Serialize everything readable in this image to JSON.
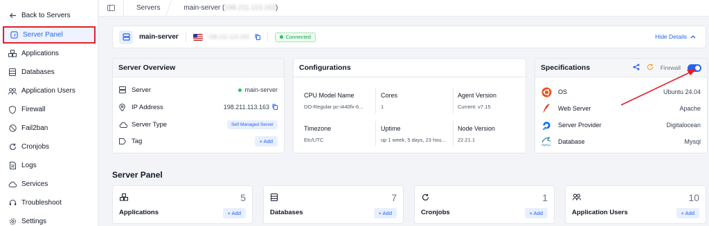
{
  "sidebar": {
    "back_label": "Back to Servers",
    "items": [
      {
        "label": "Server Panel",
        "icon": "gauge-icon"
      },
      {
        "label": "Applications",
        "icon": "cubes-icon"
      },
      {
        "label": "Databases",
        "icon": "database-icon"
      },
      {
        "label": "Application Users",
        "icon": "users-icon"
      },
      {
        "label": "Firewall",
        "icon": "shield-icon"
      },
      {
        "label": "Fail2ban",
        "icon": "ban-icon"
      },
      {
        "label": "Cronjobs",
        "icon": "refresh-icon"
      },
      {
        "label": "Logs",
        "icon": "file-icon"
      },
      {
        "label": "Services",
        "icon": "cloud-icon"
      },
      {
        "label": "Troubleshoot",
        "icon": "headset-icon"
      },
      {
        "label": "Settings",
        "icon": "gear-icon"
      }
    ]
  },
  "breadcrumb": {
    "items": [
      "Servers",
      "main-server ("
    ],
    "hidden_ip": "198.211.113.163",
    "close": ")"
  },
  "server_bar": {
    "name": "main-server",
    "ip_blurred": "198.211.113.163",
    "status": "Connected",
    "hide_details": "Hide Details"
  },
  "overview": {
    "title": "Server Overview",
    "rows": [
      {
        "label": "Server",
        "value": "main-server"
      },
      {
        "label": "IP Address",
        "value": "198.211.113.163"
      },
      {
        "label": "Server Type",
        "value": "Self Managed Server"
      },
      {
        "label": "Tag",
        "value": "+ Add"
      }
    ]
  },
  "configurations": {
    "title": "Configurations",
    "cells": [
      {
        "label": "CPU Model Name",
        "value": "DO-Regular pc-i440fx-6..."
      },
      {
        "label": "Cores",
        "value": "1"
      },
      {
        "label": "Agent Version",
        "value": "Current: v7.15"
      },
      {
        "label": "Timezone",
        "value": "Etc/UTC"
      },
      {
        "label": "Uptime",
        "value": "up 1 week, 5 days, 23 hou..."
      },
      {
        "label": "Node Version",
        "value": "22.21.1"
      }
    ]
  },
  "specifications": {
    "title": "Specifications",
    "firewall_label": "Firewall",
    "firewall_on": true,
    "rows": [
      {
        "label": "OS",
        "value": "Ubuntu 24.04"
      },
      {
        "label": "Web Server",
        "value": "Apache"
      },
      {
        "label": "Server Provider",
        "value": "Digitalocean"
      },
      {
        "label": "Database",
        "value": "Mysql"
      }
    ],
    "mysql_logo_text": "MySQL"
  },
  "server_panel": {
    "title": "Server Panel",
    "stats": [
      {
        "label": "Applications",
        "count": "5",
        "add": "+ Add"
      },
      {
        "label": "Databases",
        "count": "7",
        "add": "+ Add"
      },
      {
        "label": "Cronjobs",
        "count": "1",
        "add": "+ Add"
      },
      {
        "label": "Application Users",
        "count": "10",
        "add": "+ Add"
      }
    ]
  },
  "colors": {
    "accent": "#2563eb",
    "highlight_box": "#e11d2a",
    "connected": "#22c55e",
    "arrow": "#e11d2a"
  }
}
